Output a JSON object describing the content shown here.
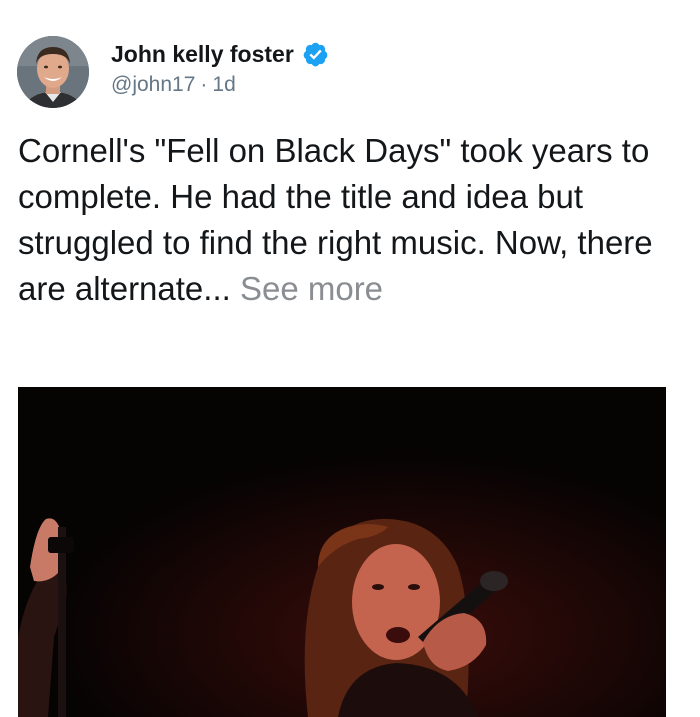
{
  "post": {
    "author_name": "John kelly foster",
    "handle": "@john17",
    "separator": "·",
    "time": "1d",
    "text": "Cornell's \"Fell on Black Days\" took years to complete. He had the title and idea but struggled to find the right music. Now, there are alternate...",
    "see_more": "See more"
  },
  "icons": {
    "verified": "verified-badge-icon",
    "avatar": "profile-photo",
    "media": "concert-photo"
  },
  "colors": {
    "verified_blue": "#1da1f2",
    "handle_gray": "#657786",
    "see_more_gray": "#8a8d91"
  }
}
